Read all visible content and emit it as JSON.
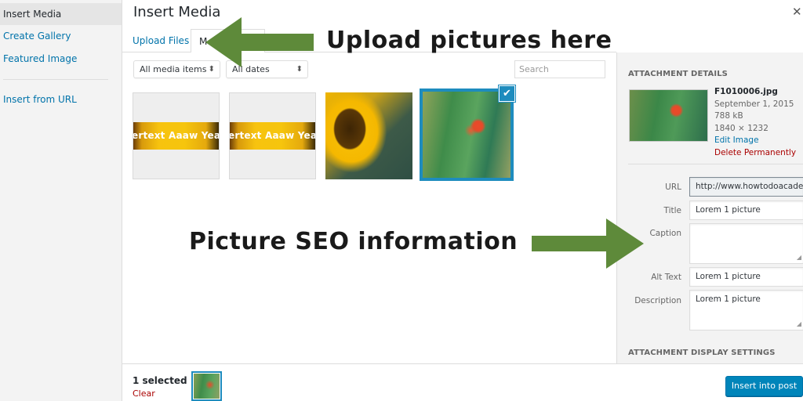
{
  "sidebar": {
    "items": [
      {
        "label": "Insert Media",
        "active": true
      },
      {
        "label": "Create Gallery"
      },
      {
        "label": "Featured Image"
      },
      {
        "label": "Insert from URL"
      }
    ]
  },
  "header": {
    "title": "Insert Media",
    "close_icon": "close-icon"
  },
  "tabs": [
    {
      "label": "Upload Files"
    },
    {
      "label": "Media Library",
      "visible_label": "M",
      "active": true
    }
  ],
  "toolbar": {
    "type_filter": "All media items",
    "date_filter": "All dates",
    "search_placeholder": "Search"
  },
  "media_items": [
    {
      "kind": "banner",
      "caption": "ertext Aaaw Yeaah"
    },
    {
      "kind": "banner",
      "caption": "ertext Aaaw Yeaah"
    },
    {
      "kind": "photo",
      "subject": "sunflower"
    },
    {
      "kind": "photo",
      "subject": "red flower",
      "selected": true
    }
  ],
  "attachment_details": {
    "heading": "ATTACHMENT DETAILS",
    "filename": "F1010006.jpg",
    "date": "September 1, 2015",
    "size": "788 kB",
    "dimensions": "1840 × 1232",
    "edit_link": "Edit Image",
    "delete_link": "Delete Permanently",
    "fields": {
      "url_label": "URL",
      "url_value": "http://www.howtodoacaden",
      "title_label": "Title",
      "title_value": "Lorem 1 picture",
      "caption_label": "Caption",
      "caption_value": "",
      "alt_label": "Alt Text",
      "alt_value": "Lorem 1 picture",
      "description_label": "Description",
      "description_value": "Lorem 1 picture"
    },
    "display_settings_heading": "ATTACHMENT DISPLAY SETTINGS"
  },
  "footer": {
    "selected_count": "1 selected",
    "clear_label": "Clear",
    "insert_button": "Insert into post"
  },
  "annotations": {
    "upload": "Upload pictures here",
    "seo": "Picture SEO information",
    "arrow_color": "#5e8a3a"
  },
  "colors": {
    "accent": "#0073aa",
    "selection": "#1e8cbe",
    "danger": "#a00",
    "primary_button": "#0085ba"
  }
}
